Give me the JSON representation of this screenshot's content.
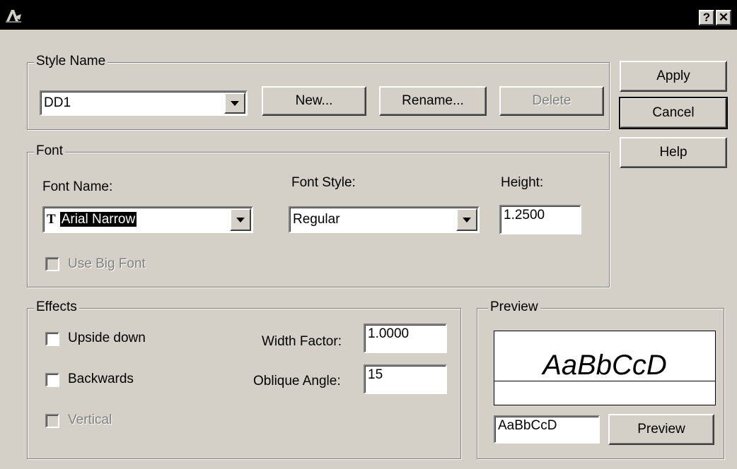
{
  "window": {
    "help_glyph": "?",
    "close_glyph": "✕"
  },
  "style_name": {
    "legend": "Style Name",
    "selected": "DD1",
    "new_label": "New...",
    "rename_label": "Rename...",
    "delete_label": "Delete"
  },
  "side_buttons": {
    "apply": "Apply",
    "cancel": "Cancel",
    "help": "Help"
  },
  "font": {
    "legend": "Font",
    "name_label": "Font Name:",
    "name_value": "Arial Narrow",
    "name_icon": "truetype-font-icon",
    "style_label": "Font Style:",
    "style_value": "Regular",
    "height_label": "Height:",
    "height_value": "1.2500",
    "big_font_label": "Use Big Font",
    "big_font_checked": false
  },
  "effects": {
    "legend": "Effects",
    "upside_down": "Upside down",
    "backwards": "Backwards",
    "vertical": "Vertical",
    "width_factor_label": "Width Factor:",
    "width_factor_value": "1.0000",
    "oblique_label": "Oblique Angle:",
    "oblique_value": "15"
  },
  "preview": {
    "legend": "Preview",
    "sample_text": "AaBbCcD",
    "input_value": "AaBbCcD",
    "button_label": "Preview"
  },
  "colors": {
    "titlebar": "#000000",
    "face": "#d4d0c8",
    "disabled_text": "#808080"
  }
}
